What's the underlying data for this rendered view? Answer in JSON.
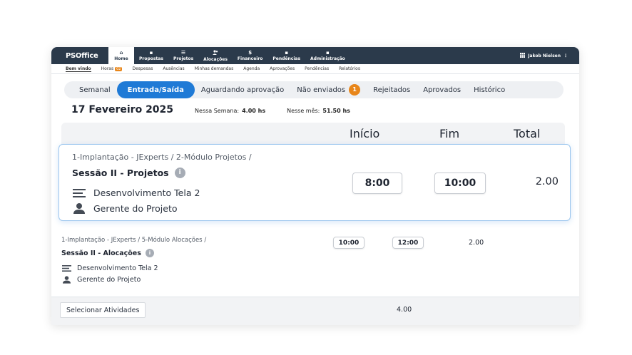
{
  "app": {
    "brand": "PSOffice",
    "user": "Jakob Nielsen"
  },
  "nav": [
    {
      "label": "Home",
      "icon": "home-icon",
      "glyph": "⌂"
    },
    {
      "label": "Propostas",
      "icon": "proposal-icon",
      "glyph": "▪"
    },
    {
      "label": "Projetos",
      "icon": "list-icon",
      "glyph": "☰"
    },
    {
      "label": "Alocações",
      "icon": "people-icon",
      "glyph": "👥"
    },
    {
      "label": "Financeiro",
      "icon": "dollar-icon",
      "glyph": "$"
    },
    {
      "label": "Pendências",
      "icon": "inbox-icon",
      "glyph": "▪"
    },
    {
      "label": "Administração",
      "icon": "briefcase-icon",
      "glyph": "▪"
    }
  ],
  "subnav": {
    "items": [
      "Bem vindo",
      "Horas",
      "Despesas",
      "Ausências",
      "Minhas demandas",
      "Agenda",
      "Aprovações",
      "Pendências",
      "Relatórios"
    ],
    "horas_badge": "02"
  },
  "tabs": [
    "Semanal",
    "Entrada/Saída",
    "Aguardando aprovação",
    "Não enviados",
    "Rejeitados",
    "Aprovados",
    "Histórico"
  ],
  "tabs_badge": "1",
  "summary": {
    "date": "17 Fevereiro 2025",
    "week_label": "Nessa Semana:",
    "week_value": "4.00 hs",
    "month_label": "Nesse mês:",
    "month_value": "51.50 hs"
  },
  "columns": {
    "start": "Início",
    "end": "Fim",
    "total": "Total"
  },
  "entries": [
    {
      "path": "1-Implantação - JExperts / 2-Módulo Projetos  /",
      "title": "Sessão II - Projetos",
      "task": "Desenvolvimento Tela 2",
      "role": "Gerente do Projeto",
      "start": "8:00",
      "end": "10:00",
      "total": "2.00"
    },
    {
      "path": "1-Implantação - JExperts / 5-Módulo Alocações  /",
      "title": "Sessão II - Alocações",
      "task": "Desenvolvimento Tela 2",
      "role": "Gerente do Projeto",
      "start": "10:00",
      "end": "12:00",
      "total": "2.00"
    }
  ],
  "footer": {
    "select_label": "Selecionar Atividades",
    "total": "4.00"
  },
  "colors": {
    "nav_bg": "#2b3a4b",
    "accent": "#1f7ad6",
    "badge": "#e8861a"
  }
}
